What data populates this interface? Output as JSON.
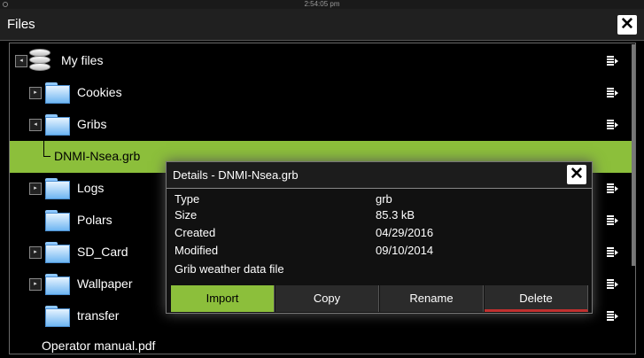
{
  "status": {
    "time": "2:54:05 pm"
  },
  "window": {
    "title": "Files",
    "close_glyph": "✕"
  },
  "tree": {
    "root": {
      "label": "My files",
      "icon": "database-icon"
    },
    "items": [
      {
        "label": "Cookies",
        "icon": "folder-icon",
        "expander": "▸"
      },
      {
        "label": "Gribs",
        "icon": "folder-icon",
        "expander": "◂"
      },
      {
        "label": "DNMI-Nsea.grb",
        "selected": true
      },
      {
        "label": "Logs",
        "icon": "folder-icon",
        "expander": "▸"
      },
      {
        "label": "Polars",
        "icon": "folder-icon"
      },
      {
        "label": "SD_Card",
        "icon": "folder-icon",
        "expander": "▸"
      },
      {
        "label": "Wallpaper",
        "icon": "folder-icon",
        "expander": "▸"
      },
      {
        "label": "transfer",
        "icon": "folder-icon"
      },
      {
        "label": "Operator manual.pdf"
      }
    ],
    "root_expander": "◂",
    "accent": "#8cbf3b"
  },
  "dialog": {
    "title": "Details - DNMI-Nsea.grb",
    "close_glyph": "✕",
    "fields": [
      {
        "key": "Type",
        "value": "grb"
      },
      {
        "key": "Size",
        "value": "85.3 kB"
      },
      {
        "key": "Created",
        "value": "04/29/2016"
      },
      {
        "key": "Modified",
        "value": "09/10/2014"
      },
      {
        "key": "Grib weather data file",
        "value": ""
      }
    ],
    "buttons": {
      "import": "Import",
      "copy": "Copy",
      "rename": "Rename",
      "delete": "Delete"
    },
    "delete_color": "#c0302f"
  }
}
